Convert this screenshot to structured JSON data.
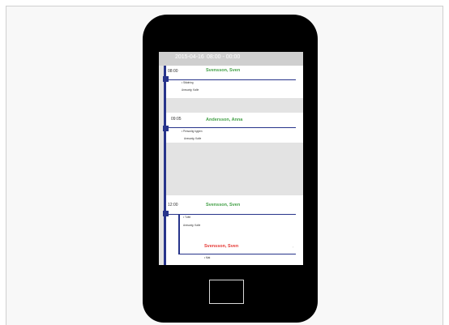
{
  "header": {
    "date": "2015-04-16",
    "time_range": "08:00 - 00:00"
  },
  "appointments": [
    {
      "time": "08:00",
      "name": "Svensson, Sven",
      "detail": "• Städning",
      "staff": "Ansvarig: Kalle"
    },
    {
      "time": "09:05",
      "name": "Andersson, Anna",
      "detail": "• Personlig hygien",
      "staff": "Ansvarig: Kalle"
    },
    {
      "time": "12:00",
      "name": "Svensson, Sven",
      "detail": "• Tvätt",
      "staff": "Ansvarig: Kalle"
    }
  ],
  "sub_appointment": {
    "name": "Svensson, Sven",
    "detail": "• Mat",
    "chevron": "›"
  },
  "colors": {
    "timeline": "#27348b",
    "name_ok": "#43a047",
    "name_alert": "#e53935",
    "header_bg": "#cfcfcf"
  }
}
